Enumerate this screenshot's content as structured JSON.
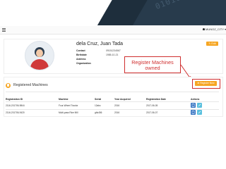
{
  "banner": {
    "digits": "01010101 01101"
  },
  "user_menu": {
    "label": "MUNOZ_CITY",
    "person_icon": "user-icon",
    "caret": "▾"
  },
  "profile": {
    "name": "dela Cruz, Juan Tada",
    "fields": [
      {
        "label": "Contact",
        "value": "09151234567"
      },
      {
        "label": "Birthdate",
        "value": "1985-10-21"
      },
      {
        "label": "Address",
        "value": ""
      },
      {
        "label": "Organization",
        "value": ""
      }
    ],
    "edit_label": "✎ Edit"
  },
  "callout": {
    "line1": "Register Machines",
    "line2": "owned",
    "color": "#cf2e2e"
  },
  "machines": {
    "title": "Registered Machines",
    "register_label": "⊕ Register New",
    "columns": [
      "Registration ID",
      "Machine",
      "Serial",
      "Year Acquired",
      "Registration Date",
      "Actions"
    ],
    "rows": [
      [
        "2116-201706-9844",
        "Four-Wheel Tractor",
        "12abc",
        "2016",
        "2017-06-05"
      ],
      [
        "2116-201706-9420",
        "Multi-pass Rice Mill",
        "ghk456",
        "2016",
        "2017-06-07"
      ]
    ]
  },
  "colors": {
    "accent": "#f6a623",
    "action_blue": "#2f6fc0",
    "action_teal": "#5bc0de",
    "banner": "#1e2e3c"
  }
}
